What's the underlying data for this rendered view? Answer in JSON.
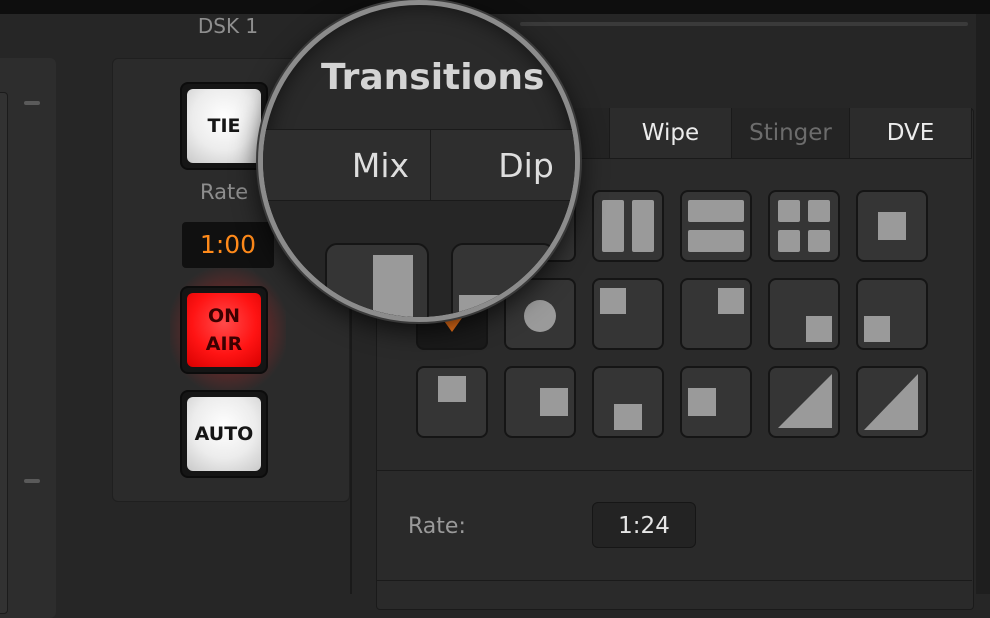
{
  "dsk": {
    "title": "DSK 1",
    "tie_label": "TIE",
    "rate_label": "Rate",
    "rate_value": "1:00",
    "on_air_line1": "ON",
    "on_air_line2": "AIR",
    "auto_label": "AUTO"
  },
  "transitions": {
    "title": "Transitions",
    "tabs": [
      {
        "label": "Mix",
        "active": false
      },
      {
        "label": "Dip",
        "active": false
      },
      {
        "label": "Wipe",
        "active": true
      },
      {
        "label": "Stinger",
        "active": false
      },
      {
        "label": "DVE",
        "active": false
      }
    ],
    "rate_label": "Rate:",
    "rate_value": "1:24",
    "selected_pattern": "left-right-wipe"
  },
  "colors": {
    "accent_orange": "#ff7a1a",
    "on_air_red": "#ff1414",
    "background": "#262626"
  }
}
